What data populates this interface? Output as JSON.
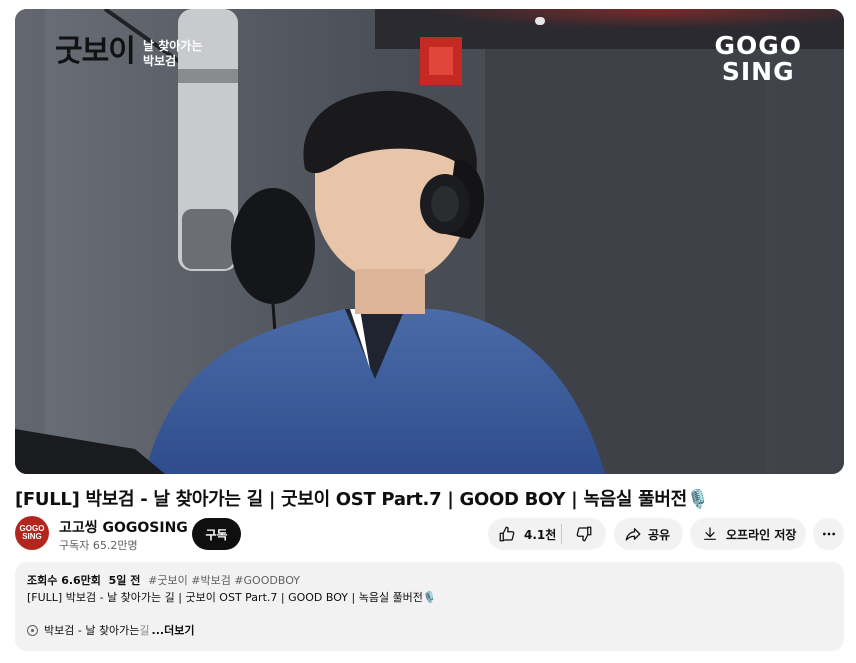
{
  "video": {
    "watermark_logo": "굿보이",
    "watermark_subtitle": [
      "날 찾아가는",
      "박보검"
    ],
    "channel_watermark": [
      "GOGO",
      "SING"
    ]
  },
  "title": "[FULL] 박보검 - 날 찾아가는 길 | 굿보이 OST Part.7 | GOOD BOY | 녹음실 풀버전🎙️",
  "channel": {
    "avatar_text": "GOGO SING",
    "name": "고고씽 GOGOSING",
    "subscribers": "구독자 65.2만명",
    "subscribe_label": "구독"
  },
  "actions": {
    "like_count": "4.1천",
    "share_label": "공유",
    "offline_label": "오프라인 저장"
  },
  "description": {
    "views": "조회수 6.6만회",
    "date": "5일 전",
    "tags": "#굿보이 #박보검 #GOODBOY",
    "text": "[FULL] 박보검 - 날 찾아가는 길 | 굿보이 OST Part.7 | GOOD BOY | 녹음실 풀버전🎙️",
    "chapter_prefix": "박보검 - 날 찾아가는 ",
    "chapter_fade": "길",
    "more_label": "...더보기"
  },
  "colors": {
    "subscribe_bg": "#0f0f0f",
    "avatar_bg": "#b3261e",
    "pill_bg": "#f2f2f2"
  },
  "icons": [
    "like-icon",
    "dislike-icon",
    "share-icon",
    "download-icon",
    "more-vert-icon",
    "disc-icon"
  ]
}
